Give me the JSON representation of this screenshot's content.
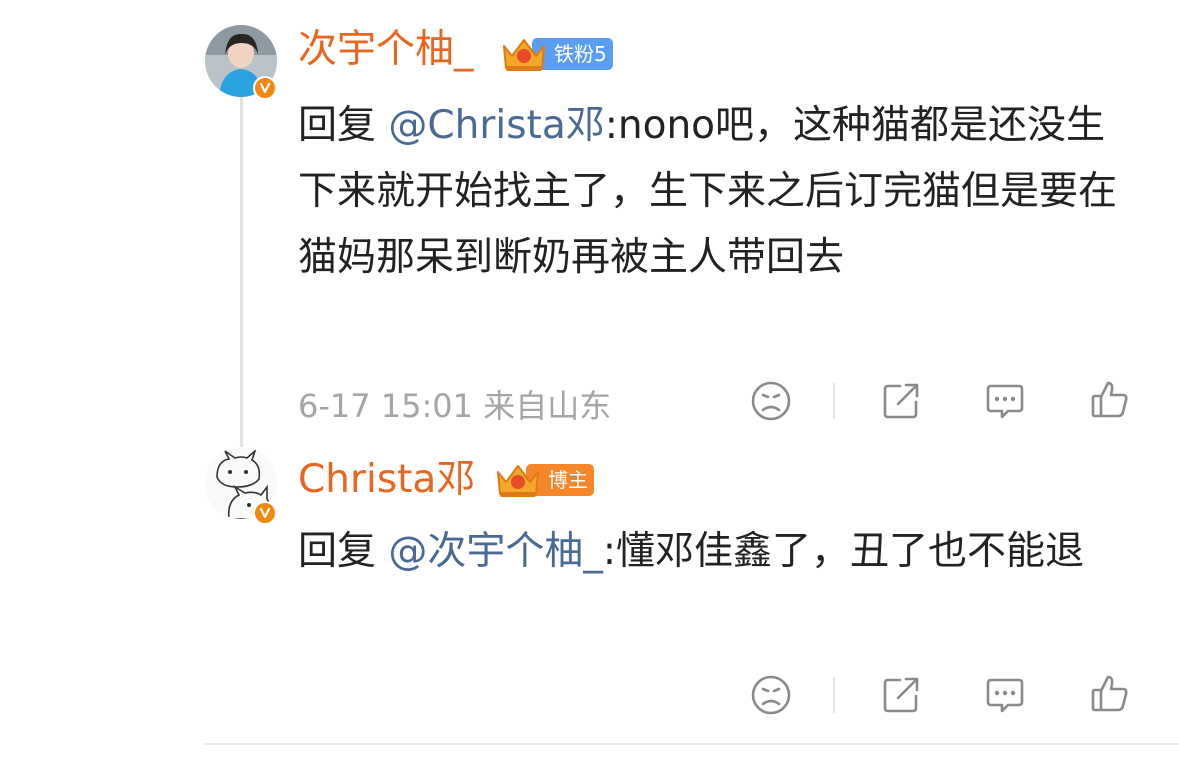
{
  "thread": [
    {
      "username": "次宇个柚_",
      "badge": {
        "label": "铁粉5",
        "color": "#5b9df0"
      },
      "reply_prefix": "回复 ",
      "mention": "@Christa邓",
      "body": ":nono吧，这种猫都是还没生下来就开始找主了，生下来之后订完猫但是要在猫妈那呆到断奶再被主人带回去",
      "meta": "6-17 15:01 来自山东"
    },
    {
      "username": "Christa邓",
      "badge": {
        "label": "博主",
        "color": "#f5862a"
      },
      "reply_prefix": "回复 ",
      "mention": "@次宇个柚_",
      "body": ":懂邓佳鑫了，丑了也不能退",
      "meta": ""
    }
  ],
  "icons": {
    "sad": "sad-face-icon",
    "share": "share-icon",
    "comment": "comment-icon",
    "like": "thumbs-up-icon"
  },
  "colors": {
    "username": "#e8661f",
    "mention": "#4a6a96",
    "meta": "#a5a5a5",
    "verified": "#f2880c"
  }
}
